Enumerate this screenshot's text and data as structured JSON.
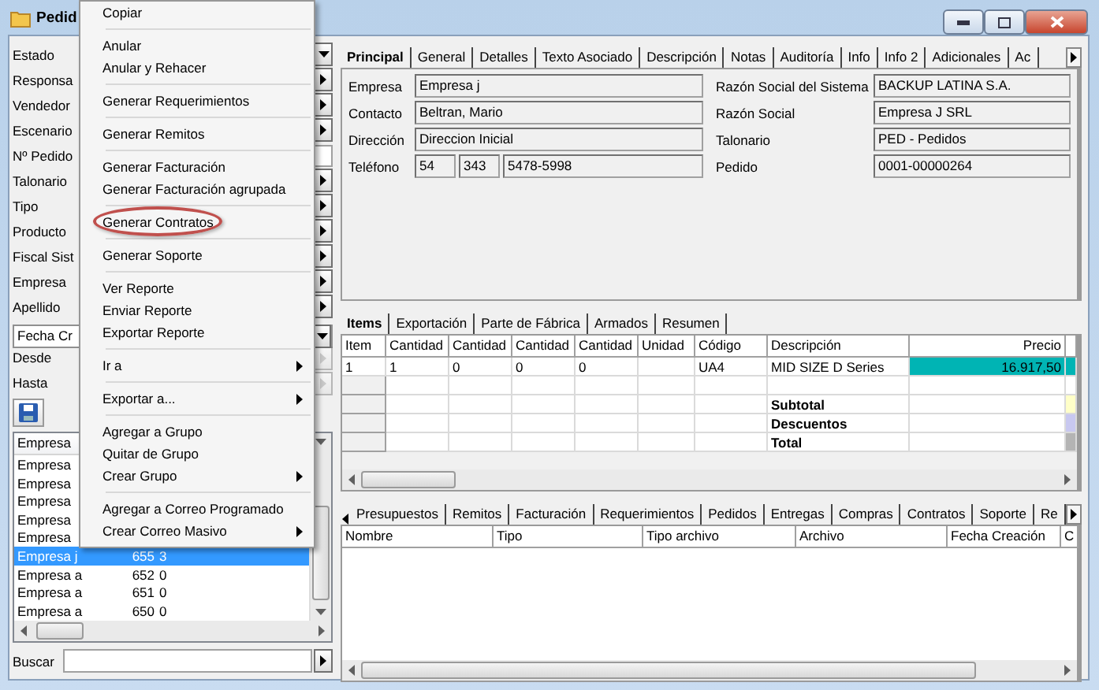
{
  "window": {
    "title": "Pedid"
  },
  "filters": [
    {
      "label": "Estado",
      "kind": "dropdown"
    },
    {
      "label": "Responsa",
      "kind": "picker"
    },
    {
      "label": "Vendedor",
      "kind": "picker"
    },
    {
      "label": "Escenario",
      "kind": "picker"
    },
    {
      "label": "Nº Pedido",
      "kind": "text"
    },
    {
      "label": "Talonario",
      "kind": "picker"
    },
    {
      "label": "Tipo",
      "kind": "picker"
    },
    {
      "label": "Producto",
      "kind": "picker"
    },
    {
      "label": "Fiscal Sist",
      "kind": "picker"
    },
    {
      "label": "Empresa",
      "kind": "picker"
    },
    {
      "label": "Apellido",
      "kind": "picker"
    }
  ],
  "date_filter": {
    "value": "Fecha Cr"
  },
  "range": [
    {
      "label": "Desde",
      "disabled": true
    },
    {
      "label": "Hasta",
      "disabled": true
    }
  ],
  "list": {
    "header": "Empresa",
    "rows": [
      {
        "name": "Empresa",
        "selected": false
      },
      {
        "name": "Empresa",
        "selected": false
      },
      {
        "name": "Empresa",
        "selected": false
      },
      {
        "name": "Empresa",
        "selected": false
      },
      {
        "name": "Empresa",
        "selected": false
      },
      {
        "name": "Empresa j",
        "number": "655",
        "count": "3",
        "selected": true
      },
      {
        "name": "Empresa a",
        "number": "652",
        "count": "0",
        "selected": false
      },
      {
        "name": "Empresa a",
        "number": "651",
        "count": "0",
        "selected": false
      },
      {
        "name": "Empresa a",
        "number": "650",
        "count": "0",
        "selected": false
      }
    ]
  },
  "search": {
    "label": "Buscar"
  },
  "context_menu": {
    "groups": [
      [
        {
          "label": "Copiar",
          "submenu": false,
          "circled": false
        }
      ],
      [
        {
          "label": "Anular",
          "submenu": false,
          "circled": false
        },
        {
          "label": "Anular y Rehacer",
          "submenu": false,
          "circled": false
        }
      ],
      [
        {
          "label": "Generar Requerimientos",
          "submenu": false,
          "circled": false
        }
      ],
      [
        {
          "label": "Generar Remitos",
          "submenu": false,
          "circled": false
        }
      ],
      [
        {
          "label": "Generar Facturación",
          "submenu": false,
          "circled": false
        },
        {
          "label": "Generar Facturación agrupada",
          "submenu": false,
          "circled": false
        }
      ],
      [
        {
          "label": "Generar Contratos",
          "submenu": false,
          "circled": true
        }
      ],
      [
        {
          "label": "Generar Soporte",
          "submenu": false,
          "circled": false
        }
      ],
      [
        {
          "label": "Ver Reporte",
          "submenu": false,
          "circled": false
        },
        {
          "label": "Enviar Reporte",
          "submenu": false,
          "circled": false
        },
        {
          "label": "Exportar Reporte",
          "submenu": false,
          "circled": false
        }
      ],
      [
        {
          "label": "Ir a",
          "submenu": true,
          "circled": false
        }
      ],
      [
        {
          "label": "Exportar a...",
          "submenu": true,
          "circled": false
        }
      ],
      [
        {
          "label": "Agregar a Grupo",
          "submenu": false,
          "circled": false
        },
        {
          "label": "Quitar de Grupo",
          "submenu": false,
          "circled": false
        },
        {
          "label": "Crear Grupo",
          "submenu": true,
          "circled": false
        }
      ],
      [
        {
          "label": "Agregar a Correo Programado",
          "submenu": false,
          "circled": false
        },
        {
          "label": "Crear Correo Masivo",
          "submenu": true,
          "circled": false
        }
      ]
    ]
  },
  "tabs": [
    {
      "label": "Principal",
      "selected": true
    },
    {
      "label": "General",
      "selected": false
    },
    {
      "label": "Detalles",
      "selected": false
    },
    {
      "label": "Texto Asociado",
      "selected": false
    },
    {
      "label": "Descripción",
      "selected": false
    },
    {
      "label": "Notas",
      "selected": false
    },
    {
      "label": "Auditoría",
      "selected": false
    },
    {
      "label": "Info",
      "selected": false
    },
    {
      "label": "Info 2",
      "selected": false
    },
    {
      "label": "Adicionales",
      "selected": false
    },
    {
      "label": "Ac",
      "selected": false
    }
  ],
  "form": {
    "left": [
      {
        "label": "Empresa",
        "values": [
          "Empresa j"
        ]
      },
      {
        "label": "Contacto",
        "values": [
          "Beltran, Mario"
        ]
      },
      {
        "label": "Dirección",
        "values": [
          "Direccion Inicial"
        ]
      },
      {
        "label": "Teléfono",
        "values": [
          "54",
          "343",
          "5478-5998"
        ]
      }
    ],
    "right": [
      {
        "label": "Razón Social del Sistema",
        "values": [
          "BACKUP LATINA S.A."
        ]
      },
      {
        "label": "Razón Social",
        "values": [
          "Empresa J SRL"
        ]
      },
      {
        "label": "Talonario",
        "values": [
          "PED - Pedidos"
        ]
      },
      {
        "label": "Pedido",
        "values": [
          "0001-00000264"
        ]
      }
    ]
  },
  "item_tabs": [
    {
      "label": "Items",
      "selected": true
    },
    {
      "label": "Exportación",
      "selected": false
    },
    {
      "label": "Parte de Fábrica",
      "selected": false
    },
    {
      "label": "Armados",
      "selected": false
    },
    {
      "label": "Resumen",
      "selected": false
    }
  ],
  "items_table": {
    "columns": [
      "Item",
      "Cantidad",
      "Cantidad",
      "Cantidad",
      "Cantidad",
      "Unidad",
      "Código",
      "Descripción",
      "Precio"
    ],
    "rows": [
      {
        "kind": "item",
        "item": "1",
        "quantities": [
          "1",
          "0",
          "0",
          "0"
        ],
        "code": "UA4",
        "description": "MID SIZE D Series",
        "price": "16.917,50",
        "selected": true
      },
      {
        "kind": "empty"
      },
      {
        "kind": "summary",
        "label": "Subtotal",
        "color": "#ffffc8"
      },
      {
        "kind": "summary",
        "label": "Descuentos",
        "color": "#c8c8f0"
      },
      {
        "kind": "summary",
        "label": "Total",
        "color": "#b4b4b4"
      }
    ]
  },
  "doc_tabs": [
    {
      "label": "Presupuestos",
      "selected": false
    },
    {
      "label": "Remitos",
      "selected": false
    },
    {
      "label": "Facturación",
      "selected": false
    },
    {
      "label": "Requerimientos",
      "selected": false
    },
    {
      "label": "Pedidos",
      "selected": false
    },
    {
      "label": "Entregas",
      "selected": false
    },
    {
      "label": "Compras",
      "selected": false
    },
    {
      "label": "Contratos",
      "selected": false
    },
    {
      "label": "Soporte",
      "selected": false
    },
    {
      "label": "Re",
      "selected": false
    }
  ],
  "doc_table": {
    "columns": [
      "Nombre",
      "Tipo",
      "Tipo archivo",
      "Archivo",
      "Fecha Creación",
      "C"
    ]
  }
}
